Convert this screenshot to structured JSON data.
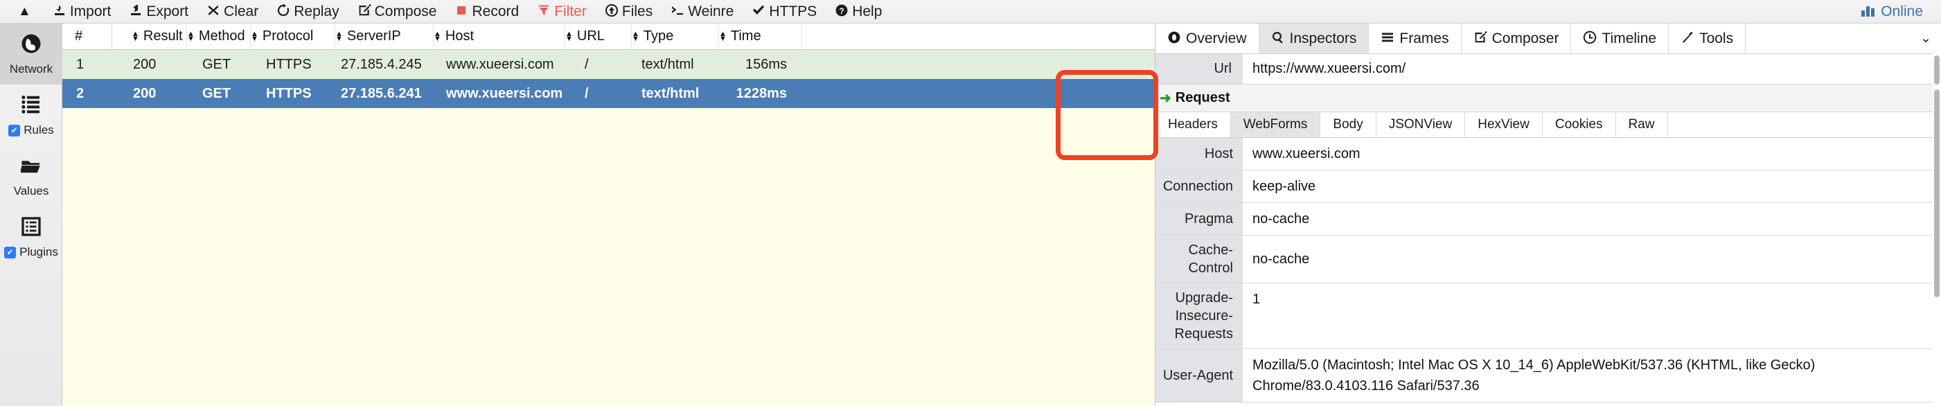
{
  "toolbar": {
    "collapse_icon": "▲",
    "items": [
      {
        "label": "Import",
        "icon": "import-icon",
        "glyph": "⇫",
        "accent": false
      },
      {
        "label": "Export",
        "icon": "export-icon",
        "glyph": "⇭",
        "accent": false
      },
      {
        "label": "Clear",
        "icon": "close-icon",
        "glyph": "✖",
        "accent": false
      },
      {
        "label": "Replay",
        "icon": "refresh-icon",
        "glyph": "↻",
        "accent": false
      },
      {
        "label": "Compose",
        "icon": "compose-icon",
        "glyph": "🖉",
        "accent": false
      },
      {
        "label": "Record",
        "icon": "record-icon",
        "glyph": "■",
        "accent": false
      },
      {
        "label": "Filter",
        "icon": "filter-icon",
        "glyph": "▼",
        "accent": true
      },
      {
        "label": "Files",
        "icon": "upload-circle-icon",
        "glyph": "⬆",
        "accent": false
      },
      {
        "label": "Weinre",
        "icon": "terminal-icon",
        "glyph": "➣",
        "accent": false
      },
      {
        "label": "HTTPS",
        "icon": "check-icon",
        "glyph": "✔",
        "accent": false
      },
      {
        "label": "Help",
        "icon": "question-circle-icon",
        "glyph": "?",
        "accent": false
      }
    ],
    "status": {
      "label": "Online",
      "icon": "bar-chart-icon",
      "color": "#3f72ab"
    }
  },
  "rail": {
    "items": [
      {
        "label": "Network",
        "icon": "globe-icon",
        "glyph": "🌐",
        "active": true,
        "checkbox": false
      },
      {
        "label": "Rules",
        "icon": "list-icon",
        "glyph": "☰",
        "active": false,
        "checkbox": true
      },
      {
        "label": "Values",
        "icon": "folder-icon",
        "glyph": "📂",
        "active": false,
        "checkbox": false
      },
      {
        "label": "Plugins",
        "icon": "plugins-icon",
        "glyph": "▤",
        "active": false,
        "checkbox": true
      }
    ],
    "checkmark": "✔"
  },
  "grid": {
    "sort_icon": "sort-arrows-icon",
    "columns": [
      {
        "key": "num",
        "label": "#",
        "sortable": false
      },
      {
        "key": "res",
        "label": "Result",
        "sortable": true
      },
      {
        "key": "met",
        "label": "Method",
        "sortable": true
      },
      {
        "key": "pro",
        "label": "Protocol",
        "sortable": true
      },
      {
        "key": "ip",
        "label": "ServerIP",
        "sortable": true
      },
      {
        "key": "host",
        "label": "Host",
        "sortable": true
      },
      {
        "key": "url",
        "label": "URL",
        "sortable": true
      },
      {
        "key": "type",
        "label": "Type",
        "sortable": true
      },
      {
        "key": "time",
        "label": "Time",
        "sortable": true
      }
    ],
    "rows": [
      {
        "num": "1",
        "res": "200",
        "met": "GET",
        "pro": "HTTPS",
        "ip": "27.185.4.245",
        "host": "www.xueersi.com",
        "url": "/",
        "type": "text/html",
        "time": "156ms",
        "selected": false
      },
      {
        "num": "2",
        "res": "200",
        "met": "GET",
        "pro": "HTTPS",
        "ip": "27.185.6.241",
        "host": "www.xueersi.com",
        "url": "/",
        "type": "text/html",
        "time": "1228ms",
        "selected": true
      }
    ]
  },
  "panel": {
    "tabs": [
      {
        "label": "Overview",
        "icon": "eye-icon",
        "glyph": "◉",
        "active": false
      },
      {
        "label": "Inspectors",
        "icon": "search-icon",
        "glyph": "🔍",
        "active": true
      },
      {
        "label": "Frames",
        "icon": "frames-icon",
        "glyph": "☰",
        "active": false
      },
      {
        "label": "Composer",
        "icon": "compose-icon",
        "glyph": "🖉",
        "active": false
      },
      {
        "label": "Timeline",
        "icon": "clock-icon",
        "glyph": "🕐",
        "active": false
      },
      {
        "label": "Tools",
        "icon": "wrench-icon",
        "glyph": "🔧",
        "active": false
      }
    ],
    "more_icon": "chevron-down-icon",
    "more_glyph": "⌄",
    "url_field": {
      "key": "Url",
      "value": "https://www.xueersi.com/"
    },
    "section": {
      "title": "Request",
      "arrow_icon": "arrow-right-icon",
      "arrow_glyph": "➜"
    },
    "subtabs": [
      {
        "label": "Headers",
        "active": false
      },
      {
        "label": "WebForms",
        "active": true
      },
      {
        "label": "Body",
        "active": false
      },
      {
        "label": "JSONView",
        "active": false
      },
      {
        "label": "HexView",
        "active": false
      },
      {
        "label": "Cookies",
        "active": false
      },
      {
        "label": "Raw",
        "active": false
      }
    ],
    "headers": [
      {
        "key": "Host",
        "value": "www.xueersi.com"
      },
      {
        "key": "Connection",
        "value": "keep-alive"
      },
      {
        "key": "Pragma",
        "value": "no-cache"
      },
      {
        "key": "Cache-Control",
        "value": "no-cache"
      },
      {
        "key": "Upgrade-Insecure-Requests",
        "value": "1"
      },
      {
        "key": "User-Agent",
        "value": "Mozilla/5.0 (Macintosh; Intel Mac OS X 10_14_6) AppleWebKit/537.36 (KHTML, like Gecko) Chrome/83.0.4103.116 Safari/537.36"
      }
    ]
  },
  "annotation": {
    "color": "#ef4123",
    "targets": "time-column-cells"
  }
}
